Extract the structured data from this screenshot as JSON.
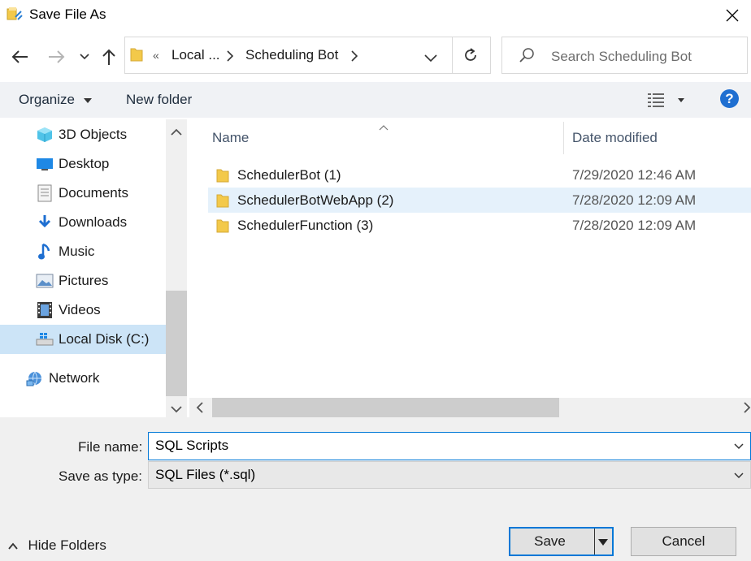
{
  "window": {
    "title": "Save File As"
  },
  "address": {
    "overflow": "«",
    "crumbs": [
      "Local ...",
      "Scheduling Bot"
    ],
    "search_placeholder": "Search Scheduling Bot"
  },
  "toolbar": {
    "organize": "Organize",
    "new_folder": "New folder",
    "help": "?"
  },
  "nav": {
    "items": [
      {
        "label": "3D Objects",
        "icon": "cube-icon"
      },
      {
        "label": "Desktop",
        "icon": "desktop-icon"
      },
      {
        "label": "Documents",
        "icon": "document-icon"
      },
      {
        "label": "Downloads",
        "icon": "download-icon"
      },
      {
        "label": "Music",
        "icon": "music-icon"
      },
      {
        "label": "Pictures",
        "icon": "pictures-icon"
      },
      {
        "label": "Videos",
        "icon": "videos-icon"
      },
      {
        "label": "Local Disk (C:)",
        "icon": "disk-icon",
        "selected": true
      },
      {
        "label": "Network",
        "icon": "network-icon"
      }
    ]
  },
  "list": {
    "columns": {
      "name": "Name",
      "date": "Date modified"
    },
    "rows": [
      {
        "name": "SchedulerBot (1)",
        "date": "7/29/2020 12:46 AM"
      },
      {
        "name": "SchedulerBotWebApp (2)",
        "date": "7/28/2020 12:09 AM",
        "hover": true
      },
      {
        "name": "SchedulerFunction (3)",
        "date": "7/28/2020 12:09 AM"
      }
    ]
  },
  "form": {
    "file_name_label": "File name:",
    "file_name_value": "SQL Scripts",
    "save_type_label": "Save as type:",
    "save_type_value": "SQL Files (*.sql)"
  },
  "footer": {
    "hide_folders": "Hide Folders",
    "save": "Save",
    "cancel": "Cancel"
  },
  "colors": {
    "accent": "#0078d7",
    "selected": "#cce4f7",
    "hover": "#e5f1fb",
    "folder": "#f3c94a"
  }
}
